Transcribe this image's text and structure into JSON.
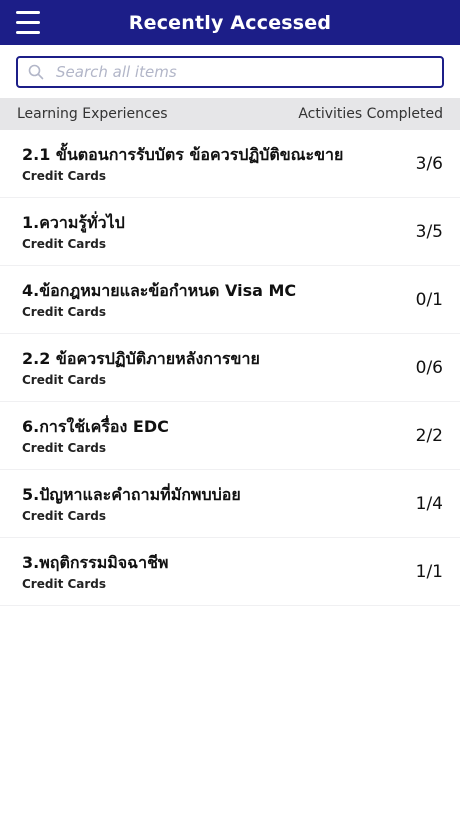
{
  "header": {
    "title": "Recently Accessed",
    "menu_icon": "hamburger-menu-icon"
  },
  "search": {
    "placeholder": "Search all items",
    "value": "",
    "icon": "search-icon"
  },
  "list_header": {
    "left": "Learning Experiences",
    "right": "Activities Completed"
  },
  "items": [
    {
      "title": "2.1 ขั้นตอนการรับบัตร ข้อควรปฏิบัติขณะขาย",
      "category": "Credit Cards",
      "completed": "3/6"
    },
    {
      "title": "1.ความรู้ทั่วไป",
      "category": "Credit Cards",
      "completed": "3/5"
    },
    {
      "title": "4.ข้อกฎหมายและข้อกำหนด Visa MC",
      "category": "Credit Cards",
      "completed": "0/1"
    },
    {
      "title": "2.2 ข้อควรปฏิบัติภายหลังการขาย",
      "category": "Credit Cards",
      "completed": "0/6"
    },
    {
      "title": "6.การใช้เครื่อง EDC",
      "category": "Credit Cards",
      "completed": "2/2"
    },
    {
      "title": "5.ปัญหาและคำถามที่มักพบบ่อย",
      "category": "Credit Cards",
      "completed": "1/4"
    },
    {
      "title": "3.พฤติกรรมมิจฉาชีพ",
      "category": "Credit Cards",
      "completed": "1/1"
    }
  ],
  "colors": {
    "brand": "#1c1e88",
    "header_bg": "#e6e6e8",
    "placeholder": "#b2b6c8"
  }
}
